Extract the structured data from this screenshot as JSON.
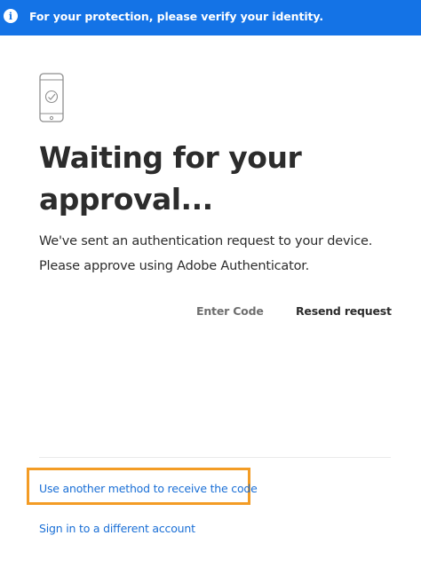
{
  "banner": {
    "icon": "info-icon",
    "text": "For your protection, please verify your identity.",
    "background_color": "#1473e6"
  },
  "main": {
    "device_icon": "phone-check-icon",
    "title": "Waiting for your approval...",
    "message": "We've sent an authentication request to your device. Please approve using Adobe Authenticator.",
    "actions": {
      "enter_code": "Enter Code",
      "resend_request": "Resend request"
    }
  },
  "footer": {
    "other_method_link": "Use another method to receive the code",
    "different_account_link": "Sign in to a different account",
    "highlight_color": "#f39c25",
    "link_color": "#1a6fd6"
  }
}
